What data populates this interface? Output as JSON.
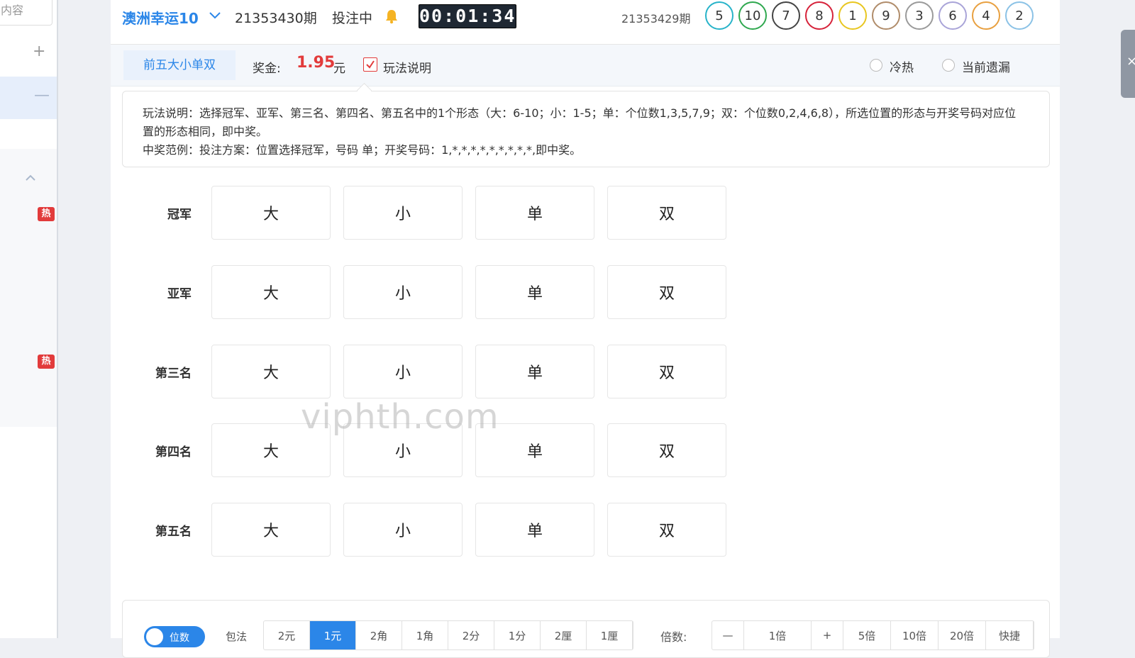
{
  "sidebar": {
    "search_placeholder": "内容",
    "plus": "+",
    "minus": "—",
    "hot_badge_1": "热",
    "hot_badge_2": "热"
  },
  "header": {
    "lottery_name": "澳洲幸运10",
    "issue_current": "21353430期",
    "status": "投注中",
    "countdown": "00:01:34",
    "issue_previous": "21353429期",
    "results": [
      {
        "num": "5",
        "color": "#27b3c9"
      },
      {
        "num": "10",
        "color": "#2fa84f"
      },
      {
        "num": "7",
        "color": "#444444"
      },
      {
        "num": "8",
        "color": "#d6223a"
      },
      {
        "num": "1",
        "color": "#e8c620"
      },
      {
        "num": "9",
        "color": "#b08c6a"
      },
      {
        "num": "3",
        "color": "#9a9a9a"
      },
      {
        "num": "6",
        "color": "#a9a4d8"
      },
      {
        "num": "4",
        "color": "#e8a040"
      },
      {
        "num": "2",
        "color": "#8bc2e6"
      }
    ]
  },
  "subbar": {
    "play_tab": "前五大小单双",
    "prize_label": "奖金:",
    "prize_value": "1.95",
    "prize_unit": "元",
    "rules_toggle": "玩法说明",
    "radio_hot_cold": "冷热",
    "radio_missing": "当前遗漏"
  },
  "rules": {
    "line1": "玩法说明：选择冠军、亚军、第三名、第四名、第五名中的1个形态（大：6-10；小：1-5；单：个位数1,3,5,7,9；双：个位数0,2,4,6,8），所选位置的形态与开奖号码对应位置的形态相同，即中奖。",
    "line2": "中奖范例：投注方案：位置选择冠军，号码 单；开奖号码：1,*,*,*,*,*,*,*,*,*,即中奖。"
  },
  "positions": [
    {
      "label": "冠军"
    },
    {
      "label": "亚军"
    },
    {
      "label": "第三名"
    },
    {
      "label": "第四名"
    },
    {
      "label": "第五名"
    }
  ],
  "options": [
    "大",
    "小",
    "单",
    "双"
  ],
  "watermark": "viphth.com",
  "bottom": {
    "toggle_label": "位数",
    "mode_label": "包法",
    "units": [
      "2元",
      "1元",
      "2角",
      "1角",
      "2分",
      "1分",
      "2厘",
      "1厘"
    ],
    "active_unit": "1元",
    "multiplier_label": "倍数:",
    "minus": "—",
    "multiplier_value": "1倍",
    "plus": "+",
    "presets": [
      "5倍",
      "10倍",
      "20倍",
      "快捷"
    ]
  },
  "right_tab": "×"
}
